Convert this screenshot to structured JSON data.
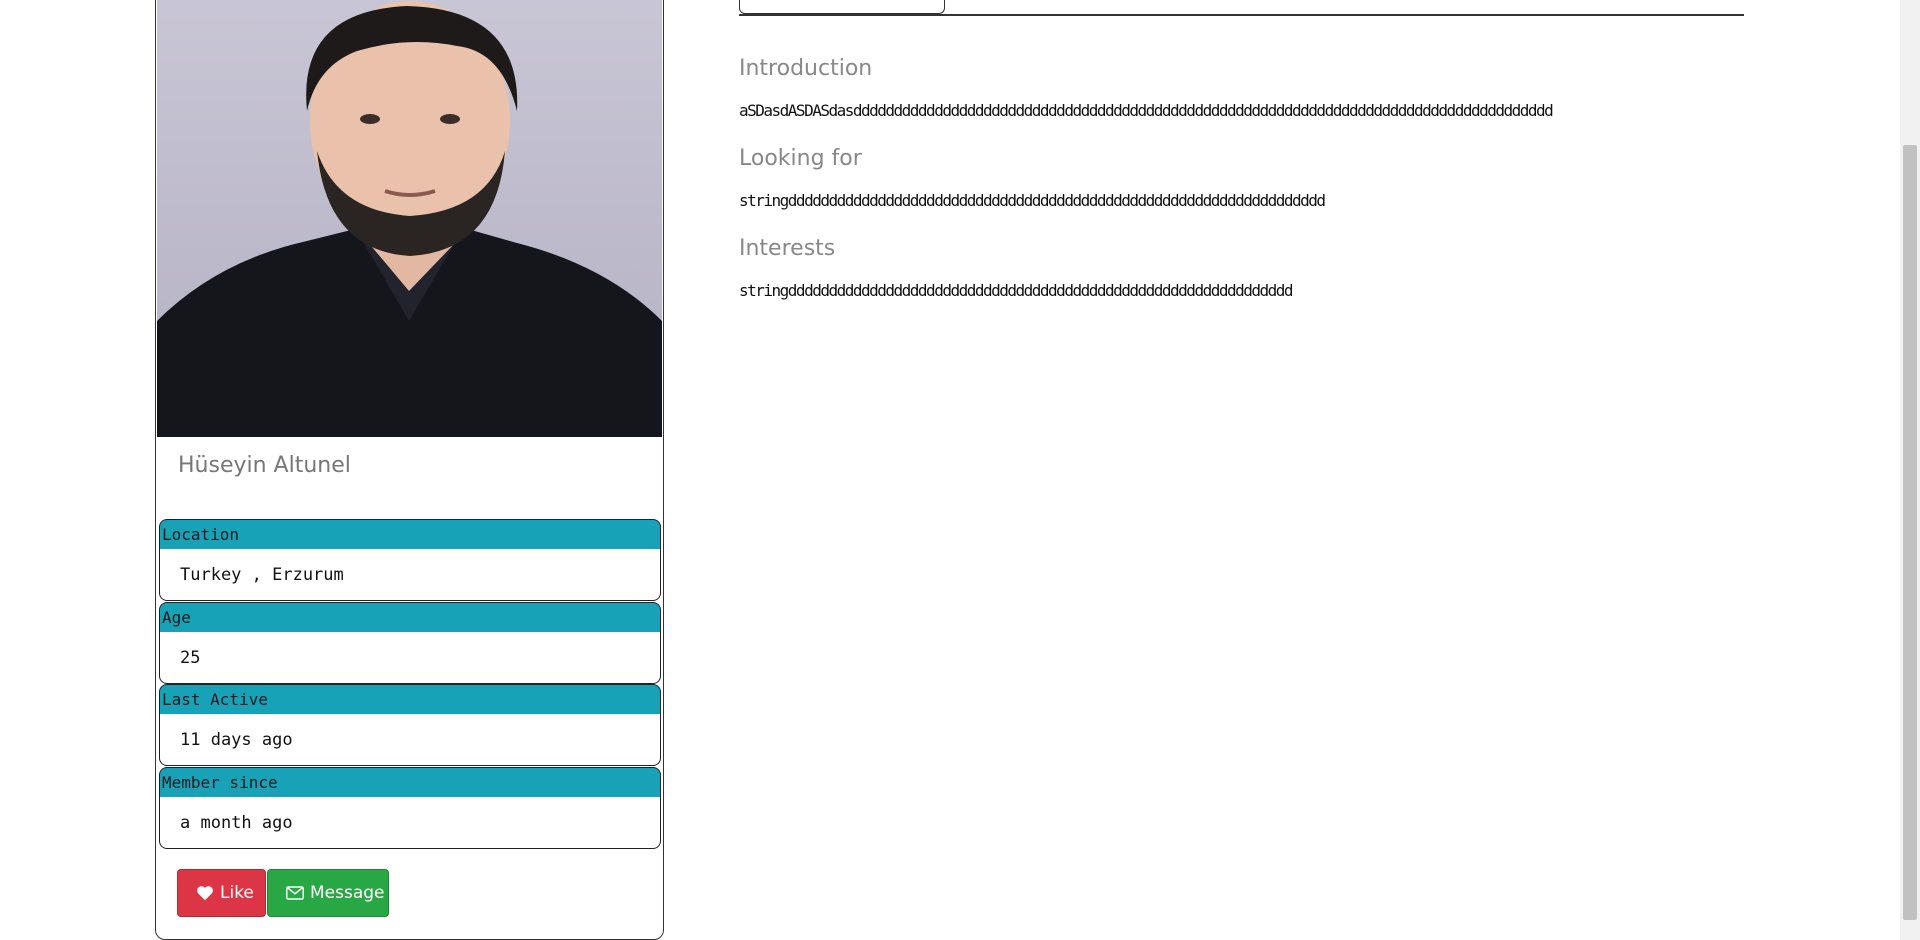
{
  "profile": {
    "name": "Hüseyin Altunel",
    "fields": [
      {
        "label": "Location",
        "value": "Turkey , Erzurum"
      },
      {
        "label": "Age",
        "value": "25"
      },
      {
        "label": "Last Active",
        "value": "11 days ago"
      },
      {
        "label": "Member since",
        "value": "a month ago"
      }
    ],
    "actions": {
      "like_label": "Like",
      "message_label": "Message"
    }
  },
  "about": {
    "introduction_title": "Introduction",
    "introduction_text": "aSDasdASDASdasdddddddddddddddddddddddddddddddddddddddddddddddddddddddddddddddddddddddddddddddddddddd",
    "looking_for_title": "Looking for",
    "looking_for_text": "stringdddddddddddddddddddddddddddddddddddddddddddddddddddddddddddddddddd",
    "interests_title": "Interests",
    "interests_text": "stringdddddddddddddddddddddddddddddddddddddddddddddddddddddddddddddd"
  },
  "colors": {
    "label_bg": "#17a2b8",
    "like_bg": "#dc3545",
    "message_bg": "#28a745"
  }
}
